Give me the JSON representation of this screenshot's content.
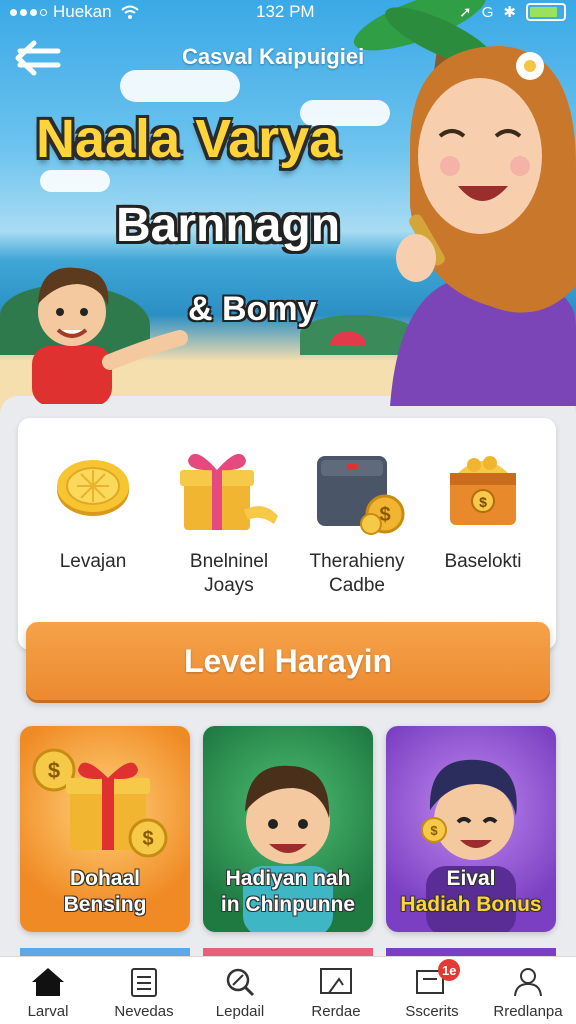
{
  "status_bar": {
    "carrier": "Huekan",
    "time": "132 PM"
  },
  "header": {
    "title": "Casval Kaipuigiei",
    "back_icon": "back-arrow-icon"
  },
  "hero": {
    "title": "Naala Varya",
    "subtitle": "Barnnagn",
    "subtitle2": "& Bomy"
  },
  "rewards": {
    "items": [
      {
        "label": "Levajan",
        "icon": "coin-icon"
      },
      {
        "label": "Bnelninel Joays",
        "icon": "gift-box-icon"
      },
      {
        "label": "Therahieny Cadbe",
        "icon": "safe-icon"
      },
      {
        "label": "Baselokti",
        "icon": "treasure-chest-icon"
      }
    ]
  },
  "level_button": {
    "label": "Level Harayin"
  },
  "promos": [
    {
      "line1": "Dohaal",
      "line2": "Bensing",
      "color": "#f08a24"
    },
    {
      "line1": "Hadiyan nah",
      "line2": "in Chinpunne",
      "color": "#1f7a42"
    },
    {
      "line1": "Eival",
      "line2": "Hadiah Bonus",
      "color": "#7a3fc2"
    }
  ],
  "bottom_nav": [
    {
      "label": "Larval",
      "icon": "home-icon"
    },
    {
      "label": "Nevedas",
      "icon": "document-list-icon"
    },
    {
      "label": "Lepdail",
      "icon": "search-magnifier-icon"
    },
    {
      "label": "Rerdae",
      "icon": "picture-frame-icon"
    },
    {
      "label": "Sscerits",
      "icon": "notification-icon",
      "badge": "1e"
    },
    {
      "label": "Rredlanpa",
      "icon": "profile-icon"
    }
  ],
  "colors": {
    "accent_orange": "#ec8a2f",
    "promo_green": "#1f7a42",
    "promo_purple": "#7a3fc2",
    "title_yellow": "#ffd43b"
  }
}
